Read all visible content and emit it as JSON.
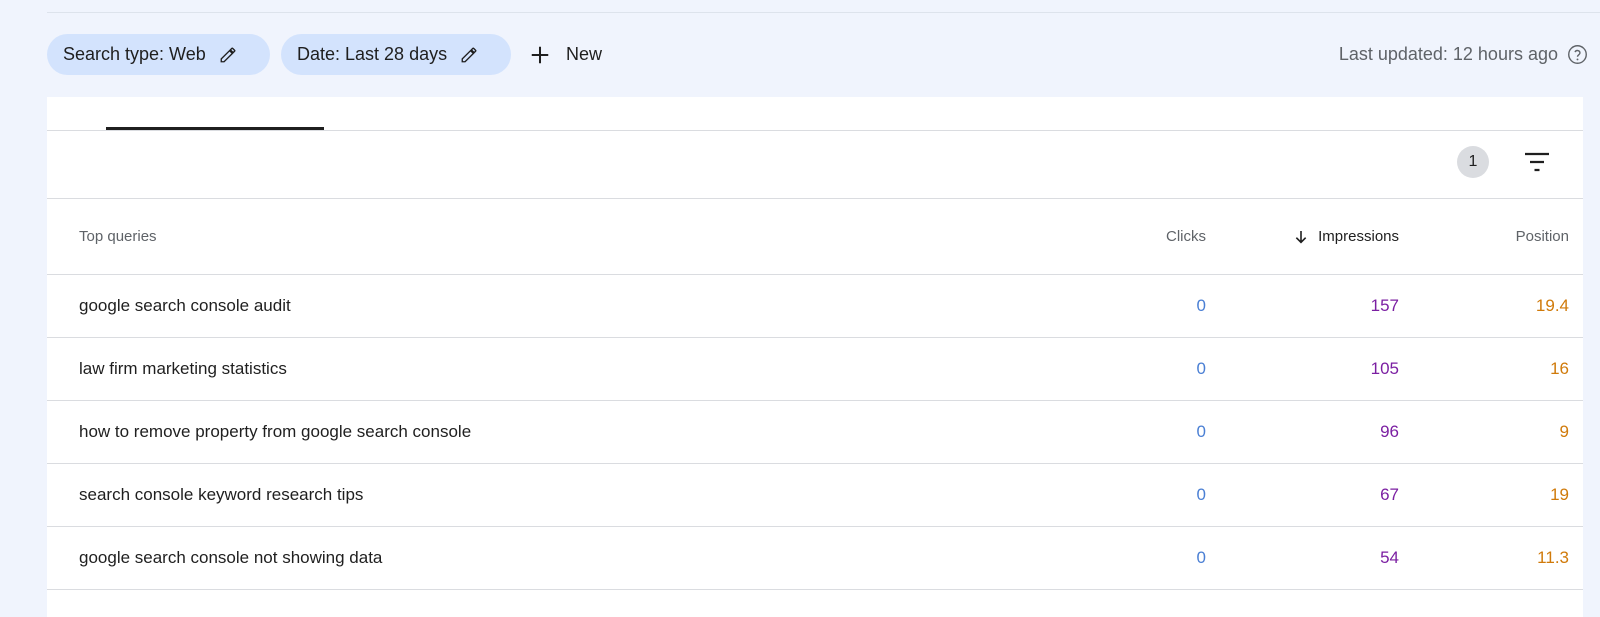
{
  "filters": {
    "search_type_label": "Search type: Web",
    "date_label": "Date: Last 28 days",
    "new_label": "New"
  },
  "status": {
    "last_updated": "Last updated: 12 hours ago"
  },
  "toolbar": {
    "active_filter_count": "1"
  },
  "table": {
    "columns": {
      "query": "Top queries",
      "clicks": "Clicks",
      "impressions": "Impressions",
      "position": "Position"
    },
    "sorted_by": "impressions",
    "sort_direction": "descending",
    "rows": [
      {
        "query": "google search console audit",
        "clicks": "0",
        "impressions": "157",
        "position": "19.4"
      },
      {
        "query": "law firm marketing statistics",
        "clicks": "0",
        "impressions": "105",
        "position": "16"
      },
      {
        "query": "how to remove property from google search console",
        "clicks": "0",
        "impressions": "96",
        "position": "9"
      },
      {
        "query": "search console keyword research tips",
        "clicks": "0",
        "impressions": "67",
        "position": "19"
      },
      {
        "query": "google search console not showing data",
        "clicks": "0",
        "impressions": "54",
        "position": "11.3"
      }
    ]
  },
  "colors": {
    "clicks": "#4a7fd4",
    "impressions": "#7b1fa2",
    "position": "#d07a0a",
    "chip_background": "#d3e3fd",
    "page_background": "#f0f4fd"
  },
  "icons": [
    "pencil-icon",
    "plus-icon",
    "help-circle-icon",
    "filter-icon",
    "arrow-down-icon"
  ]
}
